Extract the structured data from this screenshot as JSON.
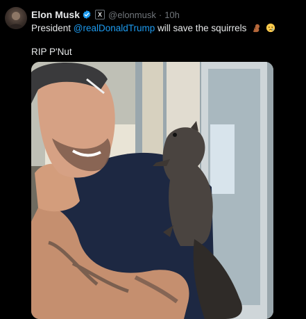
{
  "post": {
    "author_name": "Elon Musk",
    "handle": "@elonmusk",
    "separator": "·",
    "time": "10h",
    "text_before": "President ",
    "mention": "@realDonaldTrump",
    "text_after": " will save the squirrels",
    "line2": "RIP P'Nut"
  },
  "icons": {
    "verified": "verified-badge-icon",
    "affiliate": "x-affiliate-icon",
    "emoji1": "squirrel-emoji",
    "emoji2": "crying-face-emoji"
  },
  "colors": {
    "background": "#000000",
    "text": "#e7e9ea",
    "muted": "#71767b",
    "link": "#1d9bf0",
    "verified": "#1d9bf0"
  }
}
